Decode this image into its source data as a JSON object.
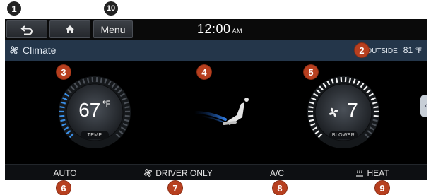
{
  "topbar": {
    "back_icon": "back-arrow-icon",
    "home_icon": "home-icon",
    "menu_label": "Menu",
    "time": "12:00",
    "ampm": "AM"
  },
  "title": {
    "icon": "fan-icon",
    "label": "Climate",
    "outside_label": "OUTSIDE",
    "outside_value": "81",
    "outside_unit": "℉"
  },
  "temp_dial": {
    "value": "67",
    "unit": "℉",
    "caption": "TEMP",
    "level": 0.3
  },
  "airflow": {
    "icon": "seat-airflow-icon"
  },
  "blower_dial": {
    "value": "7",
    "caption": "BLOWER",
    "icon": "fan-icon",
    "level": 0.875
  },
  "bottom": {
    "auto": "AUTO",
    "driver_only": "DRIVER ONLY",
    "ac": "A/C",
    "heat": "HEAT"
  },
  "callouts": [
    "1",
    "2",
    "3",
    "4",
    "5",
    "6",
    "7",
    "8",
    "9",
    "10"
  ],
  "colors": {
    "accent_blue": "#3a8ee6",
    "callout": "#b73f1f",
    "titlebar": "#24364a"
  }
}
